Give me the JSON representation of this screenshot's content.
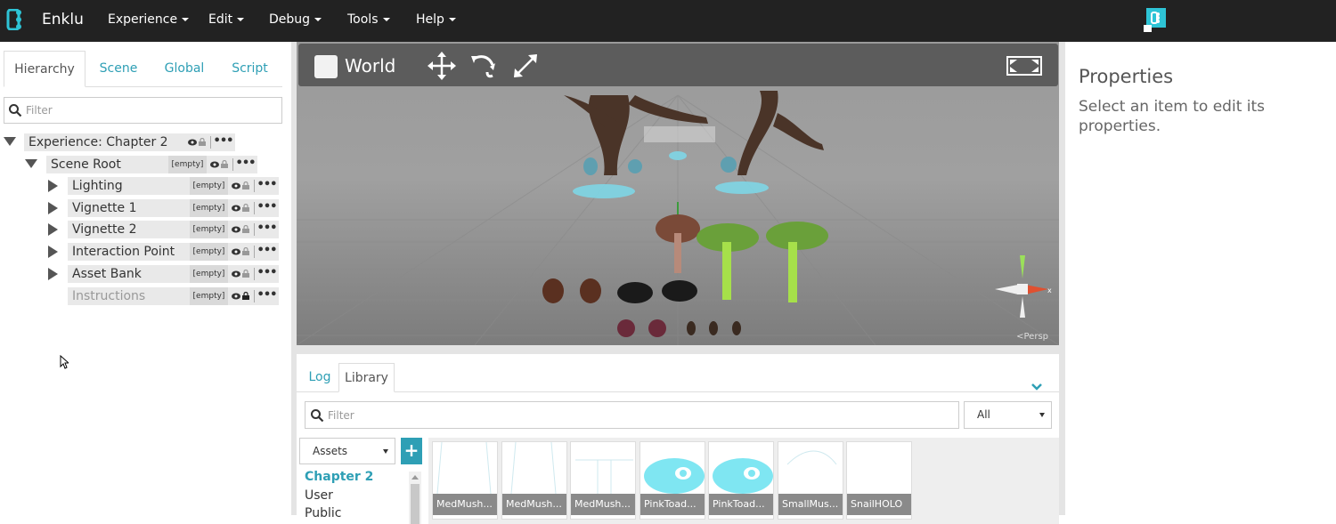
{
  "app": {
    "brand": "Enklu",
    "menus": [
      "Experience",
      "Edit",
      "Debug",
      "Tools",
      "Help"
    ],
    "accent": "#2e9fb5"
  },
  "hierarchy_panel": {
    "tabs": [
      "Hierarchy",
      "Scene",
      "Global",
      "Script"
    ],
    "active_tab": "Hierarchy",
    "filter_placeholder": "Filter",
    "tree": {
      "root": "Experience: Chapter 2",
      "scene_root": "Scene Root",
      "scene_root_badge": "[empty]",
      "children": [
        {
          "label": "Lighting",
          "badge": "[empty]"
        },
        {
          "label": "Vignette 1",
          "badge": "[empty]"
        },
        {
          "label": "Vignette 2",
          "badge": "[empty]"
        },
        {
          "label": "Interaction Point",
          "badge": "[empty]"
        },
        {
          "label": "Asset Bank",
          "badge": "[empty]"
        },
        {
          "label": "Instructions",
          "badge": "[empty]"
        }
      ],
      "more": "•••"
    }
  },
  "viewport": {
    "world_label": "World",
    "camera_label": "<Persp",
    "gizmo_axis": "x",
    "tools": [
      "move-icon",
      "rotate-icon",
      "scale-icon"
    ]
  },
  "library_panel": {
    "tabs": [
      "Log",
      "Library"
    ],
    "active_tab": "Library",
    "filter_placeholder": "Filter",
    "type_select": "All",
    "source_select": "Assets",
    "add_label": "+",
    "categories": [
      "Chapter 2",
      "User",
      "Public"
    ],
    "active_category": "Chapter 2",
    "assets": [
      "MedMush...",
      "MedMush...",
      "MedMush...",
      "PinkToad...",
      "PinkToad...",
      "SmallMus...",
      "SnailHOLO"
    ]
  },
  "properties_panel": {
    "title": "Properties",
    "hint": "Select an item to edit its properties."
  }
}
